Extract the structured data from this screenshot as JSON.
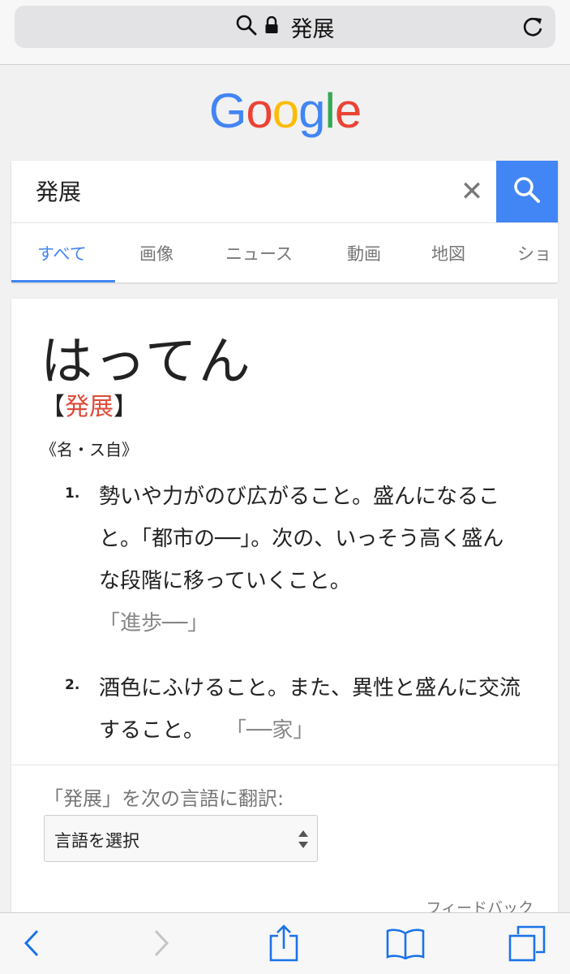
{
  "browser": {
    "address_text": "発展",
    "icons": [
      "search-icon",
      "lock-icon",
      "reload-icon"
    ]
  },
  "logo": {
    "text": [
      "G",
      "o",
      "o",
      "g",
      "l",
      "e"
    ],
    "colors": [
      "#4285f4",
      "#ea4335",
      "#fbbc05",
      "#4285f4",
      "#34a853",
      "#ea4335"
    ]
  },
  "search": {
    "query": "発展",
    "clear_label": "✕",
    "button_color": "#4285f4"
  },
  "tabs": {
    "items": [
      "すべて",
      "画像",
      "ニュース",
      "動画",
      "地図",
      "ショ"
    ],
    "active": "すべて",
    "accent": "#4285f4"
  },
  "definition": {
    "reading": "はってん",
    "kanji_open": "【",
    "kanji": "発展",
    "kanji_close": "】",
    "part_of_speech": "《名・ス自》",
    "senses": [
      {
        "num": "1.",
        "text": "勢いや力がのび広がること。盛んになること。「都市の──」。次の、いっそう高く盛んな段階に移っていくこと。",
        "example": "「進歩──」"
      },
      {
        "num": "2.",
        "text": "酒色にふけること。また、異性と盛んに交流すること。",
        "example": "「──家」"
      }
    ],
    "accent_red": "#dd4b39"
  },
  "translate": {
    "label": "「発展」を次の言語に翻訳:",
    "select_value": "言語を選択"
  },
  "feedback": "フィードバック",
  "toolbar": {
    "icons": [
      "back-icon",
      "forward-icon",
      "share-icon",
      "bookmarks-icon",
      "tabs-icon"
    ]
  }
}
